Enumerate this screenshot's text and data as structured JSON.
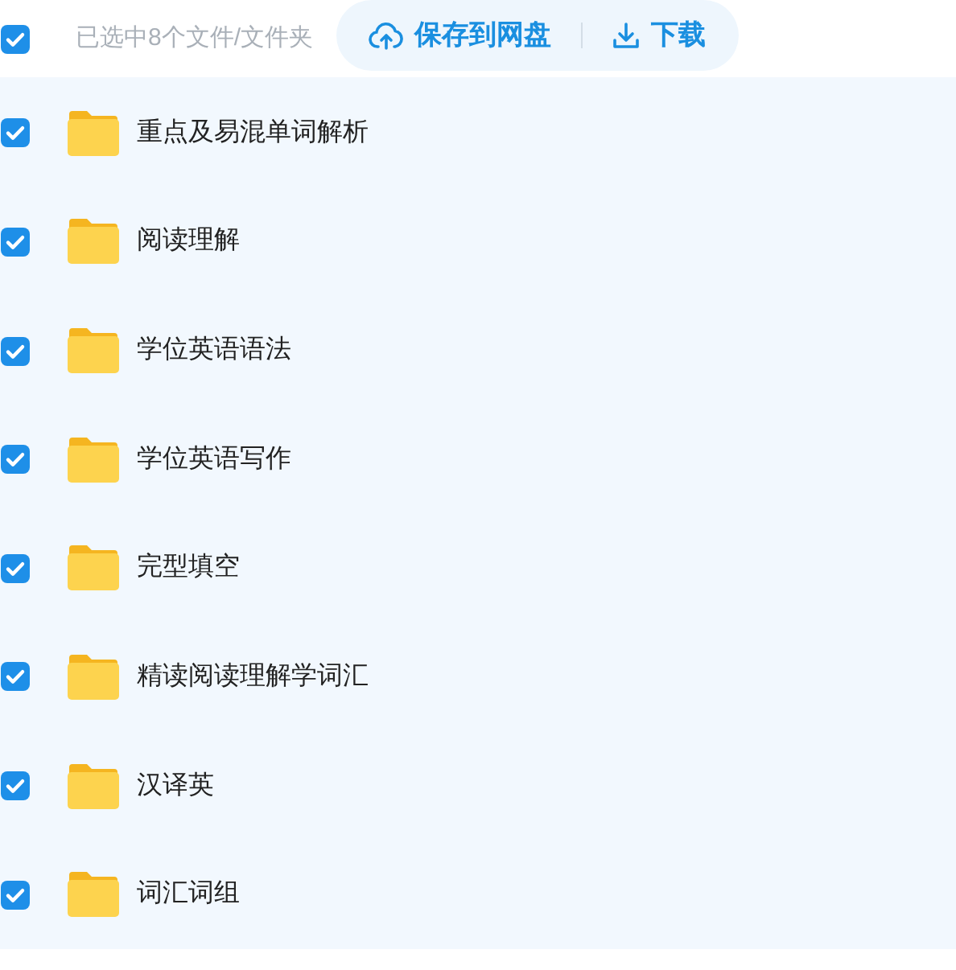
{
  "header": {
    "select_all": {
      "checked": true
    },
    "selection_text": "已选中8个文件/文件夹",
    "actions": [
      {
        "kind": "save",
        "label": "保存到网盘"
      },
      {
        "kind": "download",
        "label": "下载"
      }
    ]
  },
  "files": [
    {
      "name": "重点及易混单词解析",
      "checked": true
    },
    {
      "name": "阅读理解",
      "checked": true
    },
    {
      "name": "学位英语语法",
      "checked": true
    },
    {
      "name": "学位英语写作",
      "checked": true
    },
    {
      "name": "完型填空",
      "checked": true
    },
    {
      "name": "精读阅读理解学词汇",
      "checked": true
    },
    {
      "name": "汉译英",
      "checked": true
    },
    {
      "name": "词汇词组",
      "checked": true
    }
  ]
}
